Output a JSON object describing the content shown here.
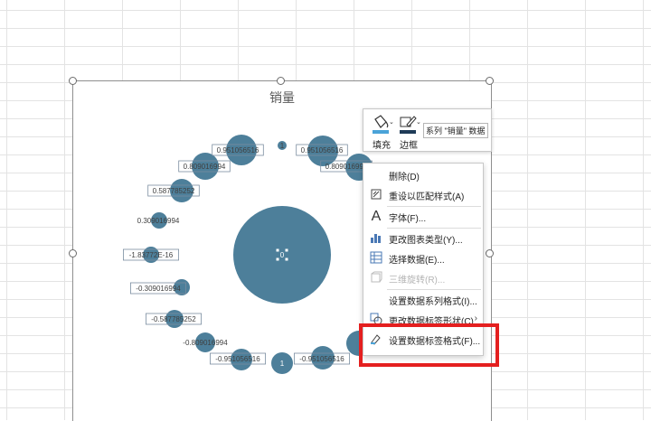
{
  "chart": {
    "title": "销量",
    "bubble_color": "#4d7f9a",
    "points": [
      {
        "label": "0",
        "size": 54,
        "boxed": false
      },
      {
        "label": "1",
        "size": 5,
        "boxed": false
      },
      {
        "label": "0.951056516",
        "size": 17,
        "boxed": true
      },
      {
        "label": "0.809016994",
        "size": 15,
        "boxed": true
      },
      {
        "label": "0.587785252",
        "size": 13,
        "boxed": true
      },
      {
        "label": "0.309016994",
        "size": 9,
        "boxed": false
      },
      {
        "label": "-1.83772E-16",
        "size": 9,
        "boxed": true
      },
      {
        "label": "-0.309016994",
        "size": 9,
        "boxed": true
      },
      {
        "label": "-0.587785252",
        "size": 10,
        "boxed": true
      },
      {
        "label": "-0.809016994",
        "size": 11,
        "boxed": false
      },
      {
        "label": "-0.951056516",
        "size": 12,
        "boxed": true
      },
      {
        "label": "1",
        "size": 12,
        "boxed": false
      },
      {
        "label": "-0.951056516",
        "size": 13,
        "boxed": true
      },
      {
        "label": "-0.809016994",
        "size": 14,
        "boxed": false
      },
      {
        "label": "0.809016994",
        "size": 15,
        "boxed": true
      },
      {
        "label": "0.951056516",
        "size": 17,
        "boxed": true
      }
    ]
  },
  "format_toolbar": {
    "fill_label": "填充",
    "border_label": "边框",
    "series_select": "系列 \"销量\" 数据"
  },
  "context_menu": {
    "items": [
      {
        "icon": "delete-icon",
        "label": "删除(D)",
        "enabled": true
      },
      {
        "icon": "reset-style-icon",
        "label": "重设以匹配样式(A)",
        "enabled": true
      },
      {
        "icon": "font-icon",
        "label": "字体(F)...",
        "enabled": true
      },
      {
        "icon": "chart-type-icon",
        "label": "更改图表类型(Y)...",
        "enabled": true
      },
      {
        "icon": "select-data-icon",
        "label": "选择数据(E)...",
        "enabled": true
      },
      {
        "icon": "3d-rotation-icon",
        "label": "三维旋转(R)...",
        "enabled": false
      },
      {
        "icon": "",
        "label": "设置数据系列格式(I)...",
        "enabled": true
      },
      {
        "icon": "label-shape-icon",
        "label": "更改数据标签形状(C)",
        "enabled": true
      },
      {
        "icon": "format-label-icon",
        "label": "设置数据标签格式(F)...",
        "enabled": true
      }
    ]
  }
}
